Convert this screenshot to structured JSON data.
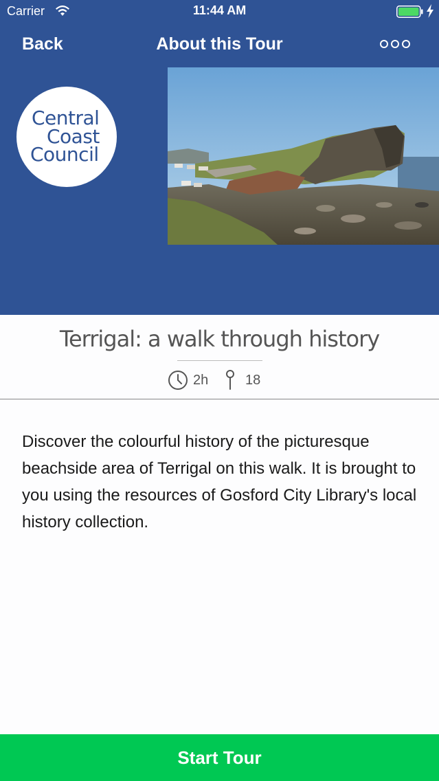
{
  "status_bar": {
    "carrier": "Carrier",
    "time": "11:44 AM",
    "battery_color": "#4cd964"
  },
  "nav": {
    "back_label": "Back",
    "title": "About this Tour",
    "more_icon": "more-dots-icon"
  },
  "header": {
    "background_color": "#2f5395",
    "logo_lines": [
      "Central",
      "Coast",
      "Council"
    ],
    "photo_alt": "coastal-headland-photo"
  },
  "tour": {
    "title": "Terrigal: a walk through history",
    "duration": "2h",
    "stops": "18",
    "description": "Discover the colourful history of the picturesque beachside area of Terrigal on this walk. It is brought to you using the resources of Gosford City Library's local history collection."
  },
  "actions": {
    "start_label": "Start Tour",
    "start_color": "#00c853"
  }
}
